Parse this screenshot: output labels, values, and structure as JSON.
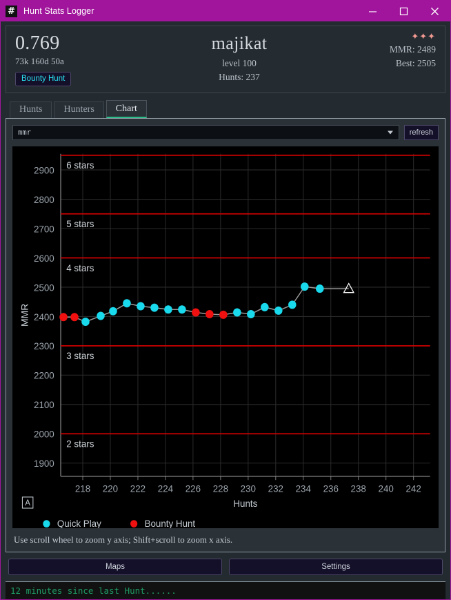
{
  "window": {
    "title": "Hunt Stats Logger",
    "icon": "hash-icon",
    "minimize_label": "minimize-icon",
    "maximize_label": "maximize-icon",
    "close_label": "close-icon",
    "accent_color": "#a0159b"
  },
  "header": {
    "kd": "0.769",
    "summary": "73k 160d 50a",
    "badge": "Bounty Hunt",
    "player_name": "majikat",
    "level": "level 100",
    "hunts": "Hunts: 237",
    "stars": "✦✦✦",
    "star_count": 3,
    "star_color": "#f49a92",
    "mmr": "MMR: 2489",
    "best": "Best: 2505"
  },
  "tabs": [
    {
      "label": "Hunts",
      "active": false
    },
    {
      "label": "Hunters",
      "active": false
    },
    {
      "label": "Chart",
      "active": true
    }
  ],
  "chart_controls": {
    "select_value": "mmr",
    "select_placeholder": "mmr",
    "caret": "chevron-down-icon",
    "refresh_label": "refresh"
  },
  "chart_hint": "Use scroll wheel to zoom y axis; Shift+scroll to zoom x axis.",
  "toolbar_toggle": {
    "label": "A",
    "name": "annotation-toggle"
  },
  "bottom_buttons": [
    {
      "label": "Maps"
    },
    {
      "label": "Settings"
    }
  ],
  "statusbar": {
    "text": "12 minutes since last Hunt......"
  },
  "chart_data": {
    "type": "line",
    "title": "",
    "xlabel": "Hunts",
    "ylabel": "MMR",
    "xlim": [
      216.4,
      243.2
    ],
    "ylim": [
      1855,
      2955
    ],
    "xticks": [
      218,
      220,
      222,
      224,
      226,
      228,
      230,
      232,
      234,
      236,
      238,
      240,
      242
    ],
    "yticks": [
      1900,
      2000,
      2100,
      2200,
      2300,
      2400,
      2500,
      2600,
      2700,
      2800,
      2900
    ],
    "grid": true,
    "grid_color": "#2a2a2a",
    "background": "#000000",
    "legend_position": "bottom-left",
    "legend": [
      {
        "name": "Quick Play",
        "color": "#19d9ec"
      },
      {
        "name": "Bounty Hunt",
        "color": "#f01010"
      }
    ],
    "threshold_lines": [
      {
        "label": "6 stars",
        "value": 2950,
        "color": "#cc0000"
      },
      {
        "label": "5 stars",
        "value": 2750,
        "color": "#cc0000"
      },
      {
        "label": "4 stars",
        "value": 2600,
        "color": "#cc0000"
      },
      {
        "label": "3 stars",
        "value": 2300,
        "color": "#cc0000"
      },
      {
        "label": "2 stars",
        "value": 2000,
        "color": "#cc0000"
      }
    ],
    "line_color": "#9a9a9a",
    "points": [
      {
        "x": 216.6,
        "y": 2398,
        "mode": "Bounty Hunt"
      },
      {
        "x": 217.4,
        "y": 2398,
        "mode": "Bounty Hunt"
      },
      {
        "x": 218.2,
        "y": 2382,
        "mode": "Quick Play"
      },
      {
        "x": 219.3,
        "y": 2402,
        "mode": "Quick Play"
      },
      {
        "x": 220.2,
        "y": 2418,
        "mode": "Quick Play"
      },
      {
        "x": 221.2,
        "y": 2445,
        "mode": "Quick Play"
      },
      {
        "x": 222.2,
        "y": 2435,
        "mode": "Quick Play"
      },
      {
        "x": 223.2,
        "y": 2430,
        "mode": "Quick Play"
      },
      {
        "x": 224.2,
        "y": 2424,
        "mode": "Quick Play"
      },
      {
        "x": 225.2,
        "y": 2424,
        "mode": "Quick Play"
      },
      {
        "x": 226.2,
        "y": 2414,
        "mode": "Bounty Hunt"
      },
      {
        "x": 227.2,
        "y": 2408,
        "mode": "Bounty Hunt"
      },
      {
        "x": 228.2,
        "y": 2406,
        "mode": "Bounty Hunt"
      },
      {
        "x": 229.2,
        "y": 2414,
        "mode": "Quick Play"
      },
      {
        "x": 230.2,
        "y": 2408,
        "mode": "Quick Play"
      },
      {
        "x": 231.2,
        "y": 2432,
        "mode": "Quick Play"
      },
      {
        "x": 232.2,
        "y": 2420,
        "mode": "Quick Play"
      },
      {
        "x": 233.2,
        "y": 2440,
        "mode": "Quick Play"
      },
      {
        "x": 234.1,
        "y": 2502,
        "mode": "Quick Play"
      },
      {
        "x": 235.2,
        "y": 2495,
        "mode": "Quick Play"
      }
    ],
    "end_marker": {
      "x": 237.3,
      "y": 2495,
      "shape": "triangle-up",
      "color": "#ffffff"
    }
  }
}
